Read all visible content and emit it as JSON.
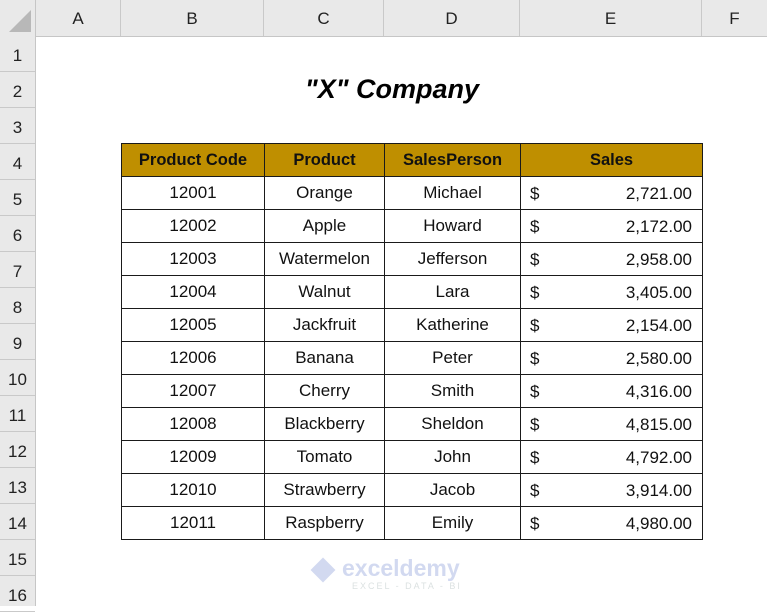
{
  "columns": [
    "A",
    "B",
    "C",
    "D",
    "E",
    "F"
  ],
  "rows": [
    "1",
    "2",
    "3",
    "4",
    "5",
    "6",
    "7",
    "8",
    "9",
    "10",
    "11",
    "12",
    "13",
    "14",
    "15",
    "16"
  ],
  "title": "\"X\" Company",
  "table": {
    "headers": [
      "Product Code",
      "Product",
      "SalesPerson",
      "Sales"
    ],
    "header_color": "#bf8f00",
    "currency_symbol": "$",
    "rows": [
      {
        "code": "12001",
        "product": "Orange",
        "person": "Michael",
        "sales": "2,721.00"
      },
      {
        "code": "12002",
        "product": "Apple",
        "person": "Howard",
        "sales": "2,172.00"
      },
      {
        "code": "12003",
        "product": "Watermelon",
        "person": "Jefferson",
        "sales": "2,958.00"
      },
      {
        "code": "12004",
        "product": "Walnut",
        "person": "Lara",
        "sales": "3,405.00"
      },
      {
        "code": "12005",
        "product": "Jackfruit",
        "person": "Katherine",
        "sales": "2,154.00"
      },
      {
        "code": "12006",
        "product": "Banana",
        "person": "Peter",
        "sales": "2,580.00"
      },
      {
        "code": "12007",
        "product": "Cherry",
        "person": "Smith",
        "sales": "4,316.00"
      },
      {
        "code": "12008",
        "product": "Blackberry",
        "person": "Sheldon",
        "sales": "4,815.00"
      },
      {
        "code": "12009",
        "product": "Tomato",
        "person": "John",
        "sales": "4,792.00"
      },
      {
        "code": "12010",
        "product": "Strawberry",
        "person": "Jacob",
        "sales": "3,914.00"
      },
      {
        "code": "12011",
        "product": "Raspberry",
        "person": "Emily",
        "sales": "4,980.00"
      }
    ]
  },
  "watermark": {
    "name": "exceldemy",
    "tagline": "EXCEL - DATA - BI"
  }
}
